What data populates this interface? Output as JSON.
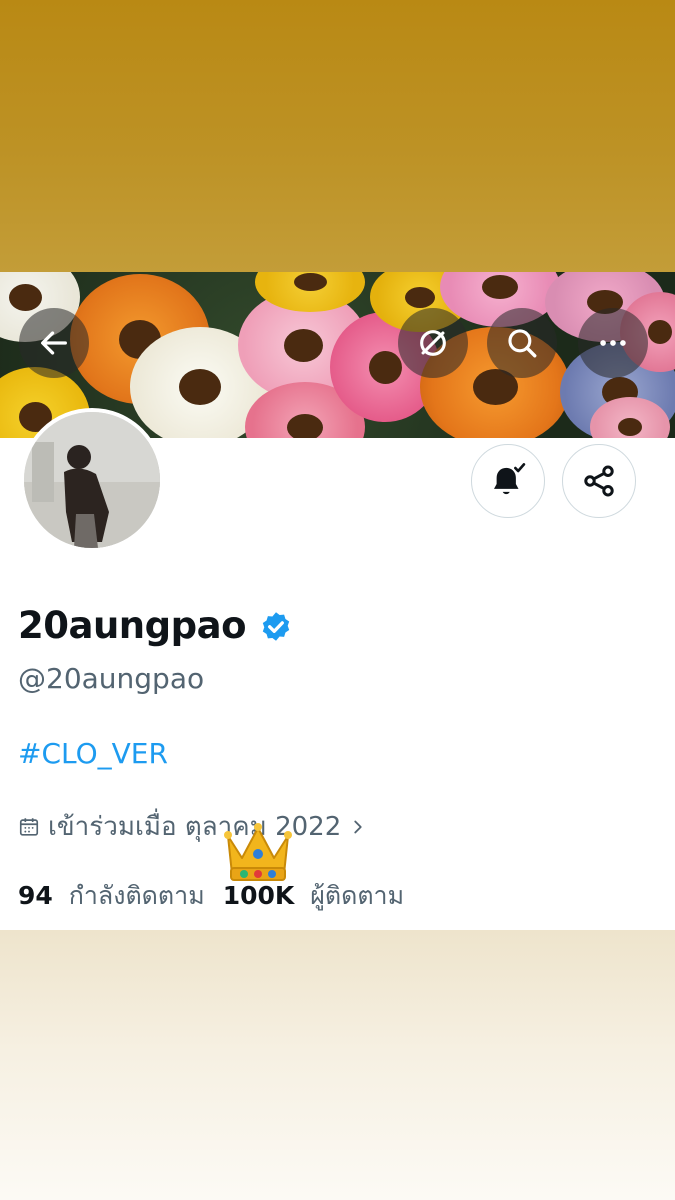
{
  "profile": {
    "display_name": "20aungpao",
    "handle": "@20aungpao",
    "verified": true,
    "bio": "#CLO_VER",
    "joined": "เข้าร่วมเมื่อ ตุลาคม 2022",
    "following_count": "94",
    "following_label": "กำลังติดตาม",
    "followers_count": "100K",
    "followers_label": "ผู้ติดตาม"
  },
  "icons": {
    "back": "arrow-left-icon",
    "translate": "circle-slash-icon",
    "search": "search-icon",
    "more": "more-icon",
    "notify": "bell-check-icon",
    "share": "share-icon",
    "calendar": "calendar-icon",
    "chevron": "chevron-right-icon",
    "crown": "crown-sticker"
  },
  "colors": {
    "accent": "#1d9bf0",
    "text_primary": "#0f1419",
    "text_secondary": "#536471",
    "top_band": "#bd9225",
    "bottom_band": "#f3ecdc"
  }
}
